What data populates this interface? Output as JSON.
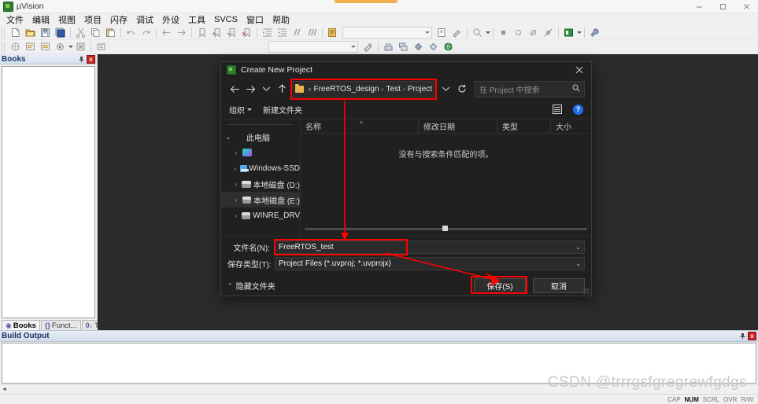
{
  "window": {
    "title": "µVision",
    "app_icon": "uvision-icon",
    "minimize": "minimize-icon",
    "maximize": "maximize-icon",
    "close": "close-icon"
  },
  "menubar": {
    "items": [
      {
        "label": "文件",
        "name": "menu-file"
      },
      {
        "label": "编辑",
        "name": "menu-edit"
      },
      {
        "label": "视图",
        "name": "menu-view"
      },
      {
        "label": "项目",
        "name": "menu-project"
      },
      {
        "label": "闪存",
        "name": "menu-flash"
      },
      {
        "label": "调试",
        "name": "menu-debug"
      },
      {
        "label": "外设",
        "name": "menu-peripherals"
      },
      {
        "label": "工具",
        "name": "menu-tools"
      },
      {
        "label": "SVCS",
        "name": "menu-svcs"
      },
      {
        "label": "窗口",
        "name": "menu-window"
      },
      {
        "label": "帮助",
        "name": "menu-help"
      }
    ]
  },
  "toolbar_main": {
    "groups": [
      [
        "new-file-icon",
        "open-file-icon",
        "save-icon",
        "save-all-icon"
      ],
      [
        "cut-icon",
        "copy-icon",
        "paste-icon"
      ],
      [
        "undo-icon",
        "redo-icon"
      ],
      [
        "navigate-back-icon",
        "navigate-forward-icon"
      ],
      [
        "bookmark-toggle-icon",
        "bookmark-prev-icon",
        "bookmark-next-icon",
        "bookmark-clear-icon"
      ],
      [
        "indent-icon",
        "outdent-icon",
        "comment-icon",
        "uncomment-icon"
      ],
      [
        "find-in-files-icon"
      ]
    ],
    "combo_value": "",
    "trailing": [
      "insert-file-icon",
      "configure-icon",
      "find-icon",
      "find-dropdown-caret"
    ]
  },
  "toolbar_build": {
    "groups": [
      [
        "translate-icon",
        "build-icon",
        "rebuild-icon",
        "batch-build-icon",
        "batch-build-caret",
        "stop-build-icon"
      ],
      [
        "target-options-icon"
      ]
    ],
    "combo_value": "",
    "right": [
      "debug-icon",
      "breakpoint-filled-icon",
      "breakpoint-empty-icon",
      "breakpoint-disable-icon",
      "breakpoint-kill-icon",
      "manage-runtime-icon",
      "manage-caret",
      "configure-wrench-icon"
    ]
  },
  "books_panel": {
    "title": "Books",
    "pin": "pin-icon",
    "close": "close-icon",
    "tabs": [
      {
        "label": "Books",
        "name": "tab-books",
        "icon": "books-icon",
        "active": true
      },
      {
        "label": "Funct...",
        "name": "tab-functions",
        "icon": "functions-icon",
        "active": false
      },
      {
        "label": "Templ...",
        "name": "tab-templates",
        "icon": "templates-icon",
        "active": false
      }
    ]
  },
  "build_output": {
    "title": "Build Output",
    "pin": "pin-icon",
    "close": "close-icon",
    "content": ""
  },
  "statusbar": {
    "message": "",
    "keys": [
      {
        "label": "CAP",
        "active": false
      },
      {
        "label": "NUM",
        "active": true
      },
      {
        "label": "SCRL",
        "active": false
      },
      {
        "label": "OVR",
        "active": false
      },
      {
        "label": "R/W",
        "active": false
      }
    ]
  },
  "watermark": "CSDN @trrrgsfgregrewfgdgs",
  "dialog": {
    "title": "Create New Project",
    "icon": "uvision-icon",
    "close": "close-icon",
    "nav": {
      "back": "arrow-left-icon",
      "forward": "arrow-right-icon",
      "recent": "chevron-down-icon",
      "up": "arrow-up-icon",
      "dropdown": "chevron-down-icon",
      "refresh": "refresh-icon"
    },
    "breadcrumb": {
      "folder_icon": "folder-icon",
      "overflow": "«",
      "segments": [
        "FreeRTOS_design",
        "Test",
        "Project"
      ],
      "separator": "›"
    },
    "search": {
      "placeholder": "在 Project 中搜索",
      "icon": "search-icon",
      "value": ""
    },
    "commands": {
      "organize": "组织",
      "new_folder": "新建文件夹",
      "view_icon": "view-layout-icon",
      "view_caret": "chevron-down-icon",
      "help_icon": "help-icon"
    },
    "tree": [
      {
        "label": "此电脑",
        "icon": "this-pc-icon",
        "expanded": true,
        "indent": 0,
        "selected": false
      },
      {
        "label": "",
        "icon": "onedrive-icon",
        "expanded": false,
        "indent": 1,
        "selected": false
      },
      {
        "label": "Windows-SSD",
        "icon": "windows-drive-icon",
        "expanded": false,
        "indent": 1,
        "selected": false
      },
      {
        "label": "本地磁盘 (D:)",
        "icon": "disk-icon",
        "expanded": false,
        "indent": 1,
        "selected": false
      },
      {
        "label": "本地磁盘 (E:)",
        "icon": "disk-icon",
        "expanded": false,
        "indent": 1,
        "selected": true
      },
      {
        "label": "WINRE_DRV",
        "icon": "disk-icon",
        "expanded": false,
        "indent": 1,
        "selected": false
      }
    ],
    "columns": [
      {
        "label": "名称",
        "name": "column-name"
      },
      {
        "label": "修改日期",
        "name": "column-date-modified"
      },
      {
        "label": "类型",
        "name": "column-type"
      },
      {
        "label": "大小",
        "name": "column-size"
      }
    ],
    "sort_indicator": "^",
    "empty_message": "没有与搜索条件匹配的项。",
    "filename": {
      "label": "文件名(N):",
      "value": "FreeRTOS_test",
      "caret": "chevron-down-icon"
    },
    "filetype": {
      "label": "保存类型(T):",
      "value": "Project Files (*.uvproj; *.uvprojx)",
      "caret": "chevron-down-icon"
    },
    "hide_folders": {
      "label": "隐藏文件夹",
      "caret": "chevron-up-icon"
    },
    "buttons": {
      "save": "保存(S)",
      "cancel": "取消"
    }
  },
  "annotations": {
    "highlight_color": "#ff0000",
    "targets": [
      "breadcrumb",
      "filename-field",
      "save-button"
    ]
  }
}
